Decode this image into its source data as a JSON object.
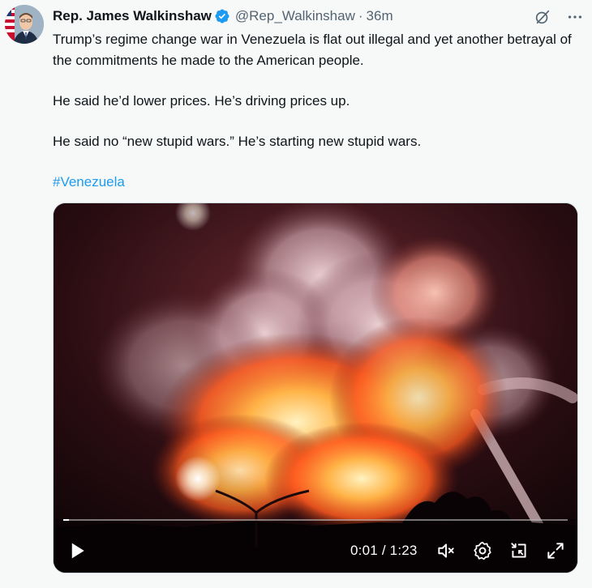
{
  "author": {
    "name": "Rep. James Walkinshaw",
    "handle": "@Rep_Walkinshaw",
    "separator": "·",
    "time": "36m"
  },
  "tweet": {
    "paragraphs": [
      "Trump’s regime change war in Venezuela is flat out illegal and yet another betrayal of the commitments he made to the American people.",
      "He said he’d lower prices. He’s driving prices up.",
      "He said no “new stupid wars.” He’s starting new stupid wars."
    ],
    "hashtag": "#Venezuela"
  },
  "video": {
    "current_time": "0:01",
    "separator": " / ",
    "duration": "1:23",
    "progress_fraction": 0.012
  },
  "icons": {
    "top_right": [
      "grok-icon",
      "more-icon"
    ],
    "controls": [
      "play-icon",
      "muted-volume-icon",
      "settings-icon",
      "pip-icon",
      "fullscreen-icon"
    ]
  },
  "colors": {
    "accent": "#1d9bf0",
    "text": "#0f1419",
    "secondary": "#536471",
    "background": "#f7f9f9"
  }
}
